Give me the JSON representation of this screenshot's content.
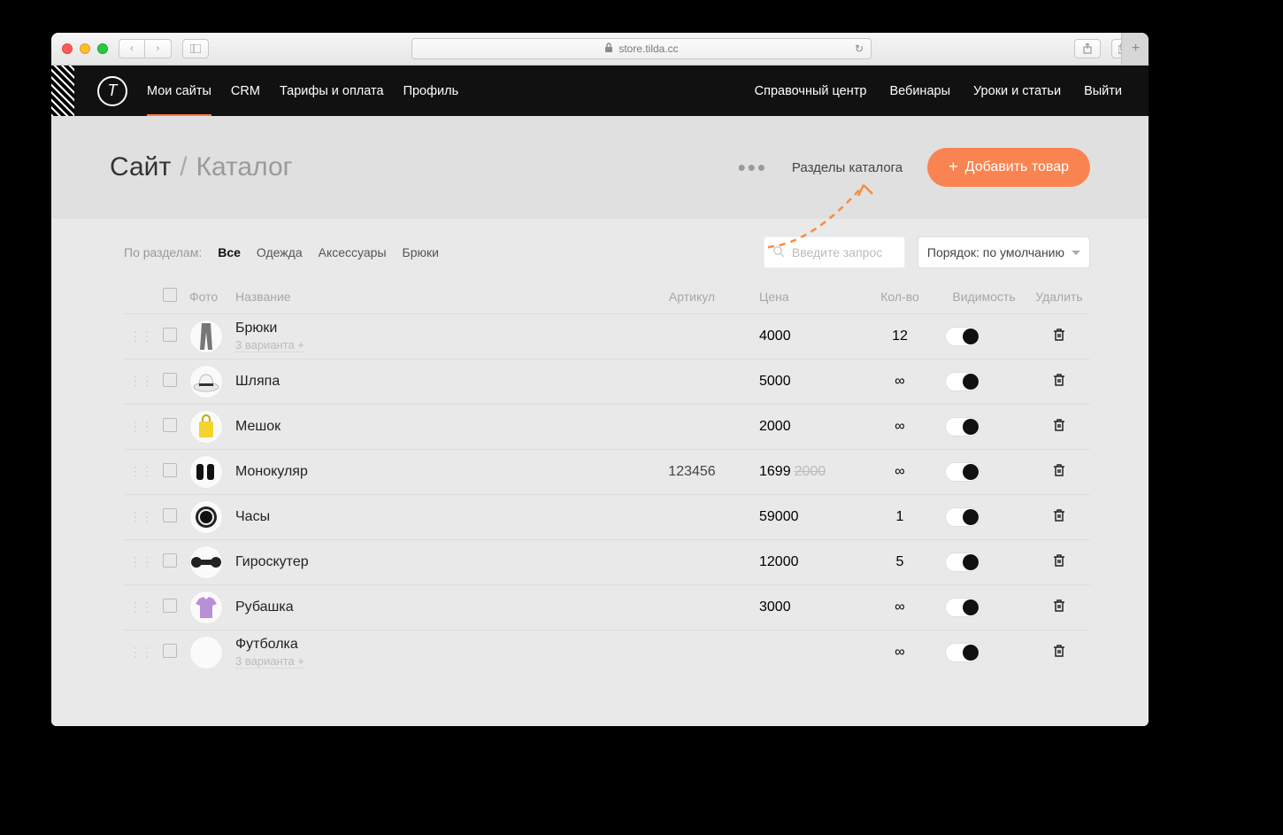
{
  "browser": {
    "url_host": "store.tilda.cc"
  },
  "header": {
    "logo_letter": "T",
    "left": [
      "Мои сайты",
      "CRM",
      "Тарифы и оплата",
      "Профиль"
    ],
    "active_index": 0,
    "right": [
      "Справочный центр",
      "Вебинары",
      "Уроки и статьи",
      "Выйти"
    ]
  },
  "crumb": {
    "root": "Сайт",
    "sep": "/",
    "sub": "Каталог"
  },
  "crumb_actions": {
    "catalog_sections": "Разделы каталога",
    "add_product": "Добавить товар"
  },
  "filters": {
    "label": "По разделам:",
    "chips": [
      "Все",
      "Одежда",
      "Аксессуары",
      "Брюки"
    ],
    "active_index": 0,
    "search_placeholder": "Введите запрос",
    "sort_label": "Порядок: по умолчанию"
  },
  "table": {
    "columns": {
      "photo": "Фото",
      "name": "Название",
      "sku": "Артикул",
      "price": "Цена",
      "qty": "Кол-во",
      "visibility": "Видимость",
      "delete": "Удалить"
    },
    "rows": [
      {
        "name": "Брюки",
        "variants": "3 варианта +",
        "sku": "",
        "price": "4000",
        "old_price": "",
        "qty": "12",
        "thumb": "pants"
      },
      {
        "name": "Шляпа",
        "variants": "",
        "sku": "",
        "price": "5000",
        "old_price": "",
        "qty": "∞",
        "thumb": "hat"
      },
      {
        "name": "Мешок",
        "variants": "",
        "sku": "",
        "price": "2000",
        "old_price": "",
        "qty": "∞",
        "thumb": "bag"
      },
      {
        "name": "Монокуляр",
        "variants": "",
        "sku": "123456",
        "price": "1699",
        "old_price": "2000",
        "qty": "∞",
        "thumb": "monocular"
      },
      {
        "name": "Часы",
        "variants": "",
        "sku": "",
        "price": "59000",
        "old_price": "",
        "qty": "1",
        "thumb": "watch"
      },
      {
        "name": "Гироскутер",
        "variants": "",
        "sku": "",
        "price": "12000",
        "old_price": "",
        "qty": "5",
        "thumb": "hover"
      },
      {
        "name": "Рубашка",
        "variants": "",
        "sku": "",
        "price": "3000",
        "old_price": "",
        "qty": "∞",
        "thumb": "shirt"
      },
      {
        "name": "Футболка",
        "variants": "3 варианта +",
        "sku": "",
        "price": "",
        "old_price": "",
        "qty": "∞",
        "thumb": "blank"
      }
    ]
  }
}
